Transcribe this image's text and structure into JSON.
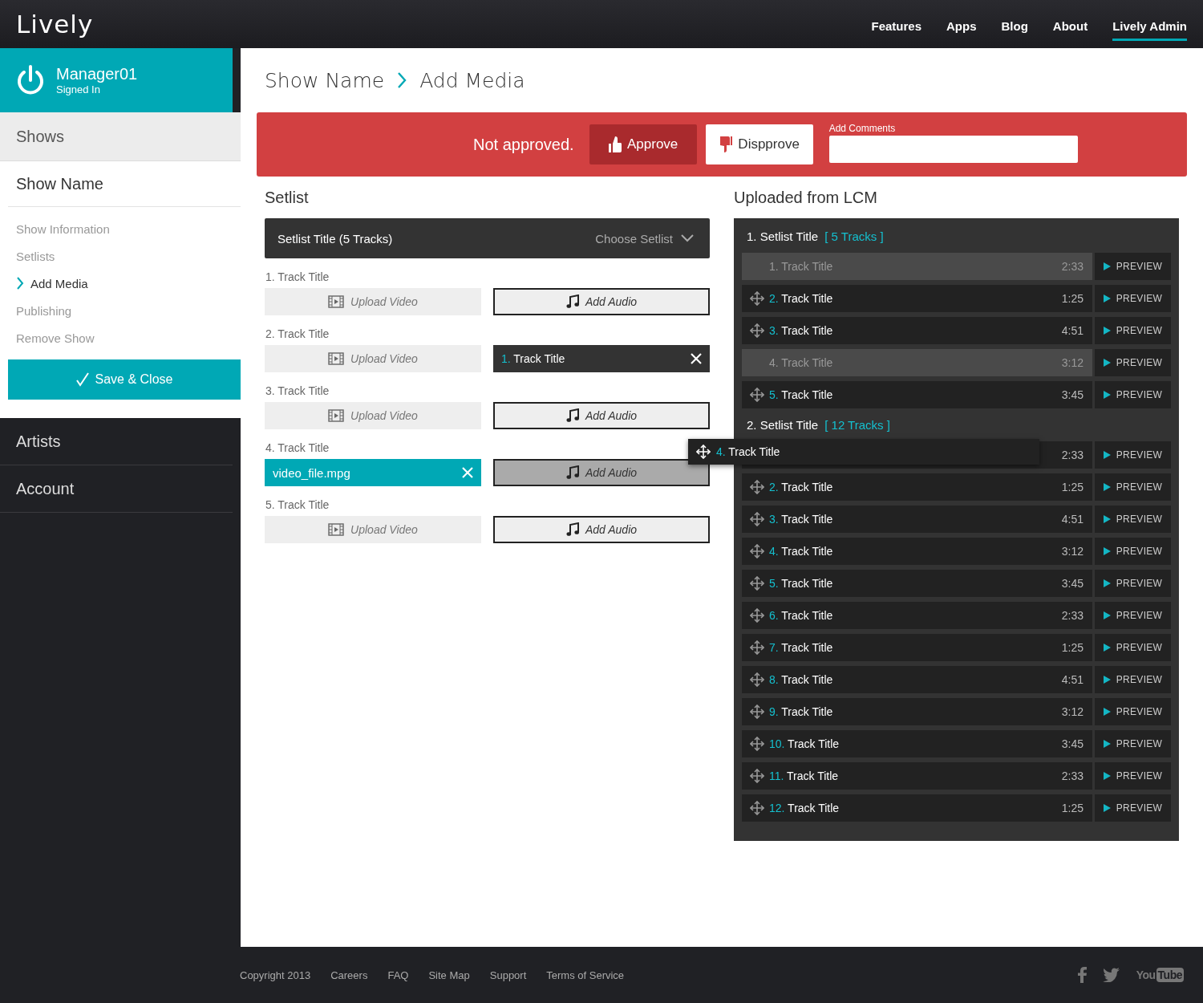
{
  "header": {
    "logo": "Lively",
    "nav": [
      {
        "label": "Features",
        "selected": false
      },
      {
        "label": "Apps",
        "selected": false
      },
      {
        "label": "Blog",
        "selected": false
      },
      {
        "label": "About",
        "selected": false
      },
      {
        "label": "Lively Admin",
        "selected": true
      }
    ]
  },
  "sidebar": {
    "user": {
      "name": "Manager01",
      "status": "Signed In"
    },
    "shows_label": "Shows",
    "show": {
      "title": "Show Name",
      "items": [
        {
          "label": "Show Information",
          "selected": false
        },
        {
          "label": "Setlists",
          "selected": false
        },
        {
          "label": "Add Media",
          "selected": true
        },
        {
          "label": "Publishing",
          "selected": false
        },
        {
          "label": "Remove Show",
          "selected": false
        }
      ],
      "save_button": "Save & Close"
    },
    "links": [
      "Artists",
      "Account"
    ]
  },
  "breadcrumb": [
    "Show Name",
    "Add Media"
  ],
  "approval": {
    "status": "Not approved.",
    "buttons": [
      {
        "kind": "approve",
        "label": "Approve"
      },
      {
        "kind": "disapprove",
        "label": "Dispprove"
      }
    ],
    "comments_label": "Add Comments"
  },
  "setlist": {
    "heading": "Setlist",
    "selector": {
      "title": "Setlist Title (5 Tracks)",
      "placeholder": "Choose Setlist"
    },
    "tracks": [
      {
        "label": "1. Track Title",
        "video": {
          "kind": "upload",
          "label": "Upload Video"
        },
        "audio": {
          "kind": "add",
          "label": "Add Audio",
          "highlighted": false
        }
      },
      {
        "label": "2. Track Title",
        "video": {
          "kind": "upload",
          "label": "Upload Video"
        },
        "audio": {
          "kind": "assigned",
          "number": "1.",
          "title": "Track Title"
        }
      },
      {
        "label": "3. Track Title",
        "video": {
          "kind": "upload",
          "label": "Upload Video"
        },
        "audio": {
          "kind": "add",
          "label": "Add Audio",
          "highlighted": false
        }
      },
      {
        "label": "4. Track Title",
        "video": {
          "kind": "file",
          "filename": "video_file.mpg"
        },
        "audio": {
          "kind": "add",
          "label": "Add Audio",
          "highlighted": true
        }
      },
      {
        "label": "5. Track Title",
        "video": {
          "kind": "upload",
          "label": "Upload Video"
        },
        "audio": {
          "kind": "add",
          "label": "Add Audio",
          "highlighted": false
        }
      }
    ]
  },
  "lcm": {
    "heading": "Uploaded from LCM",
    "setlists": [
      {
        "title": "1. Setlist Title",
        "count": "[ 5 Tracks ]",
        "tracks": [
          {
            "number": "1.",
            "title": "Track Title",
            "time": "2:33",
            "used": true,
            "preview": "PREVIEW"
          },
          {
            "number": "2.",
            "title": "Track Title",
            "time": "1:25",
            "used": false,
            "preview": "PREVIEW"
          },
          {
            "number": "3.",
            "title": "Track Title",
            "time": "4:51",
            "used": false,
            "preview": "PREVIEW"
          },
          {
            "number": "4.",
            "title": "Track Title",
            "time": "3:12",
            "used": true,
            "preview": "PREVIEW"
          },
          {
            "number": "5.",
            "title": "Track Title",
            "time": "3:45",
            "used": false,
            "preview": "PREVIEW"
          }
        ]
      },
      {
        "title": "2. Setlist Title",
        "count": "[ 12 Tracks ]",
        "tracks": [
          {
            "time": "2:33",
            "used": false,
            "preview": "PREVIEW"
          },
          {
            "number": "2.",
            "title": "Track Title",
            "time": "1:25",
            "used": false,
            "preview": "PREVIEW"
          },
          {
            "number": "3.",
            "title": "Track Title",
            "time": "4:51",
            "used": false,
            "preview": "PREVIEW"
          },
          {
            "number": "4.",
            "title": "Track Title",
            "time": "3:12",
            "used": false,
            "preview": "PREVIEW"
          },
          {
            "number": "5.",
            "title": "Track Title",
            "time": "3:45",
            "used": false,
            "preview": "PREVIEW"
          },
          {
            "number": "6.",
            "title": "Track Title",
            "time": "2:33",
            "used": false,
            "preview": "PREVIEW"
          },
          {
            "number": "7.",
            "title": "Track Title",
            "time": "1:25",
            "used": false,
            "preview": "PREVIEW"
          },
          {
            "number": "8.",
            "title": "Track Title",
            "time": "4:51",
            "used": false,
            "preview": "PREVIEW"
          },
          {
            "number": "9.",
            "title": "Track Title",
            "time": "3:12",
            "used": false,
            "preview": "PREVIEW"
          },
          {
            "number": "10.",
            "title": "Track Title",
            "time": "3:45",
            "used": false,
            "preview": "PREVIEW"
          },
          {
            "number": "11.",
            "title": "Track Title",
            "time": "2:33",
            "used": false,
            "preview": "PREVIEW"
          },
          {
            "number": "12.",
            "title": "Track Title",
            "time": "1:25",
            "used": false,
            "preview": "PREVIEW"
          }
        ]
      }
    ],
    "drag_item": {
      "number": "4.",
      "title": "Track Title"
    }
  },
  "footer": {
    "links": [
      "Copyright 2013",
      "Careers",
      "FAQ",
      "Site Map",
      "Support",
      "Terms of Service"
    ],
    "youtube": [
      "You",
      "Tube"
    ]
  }
}
